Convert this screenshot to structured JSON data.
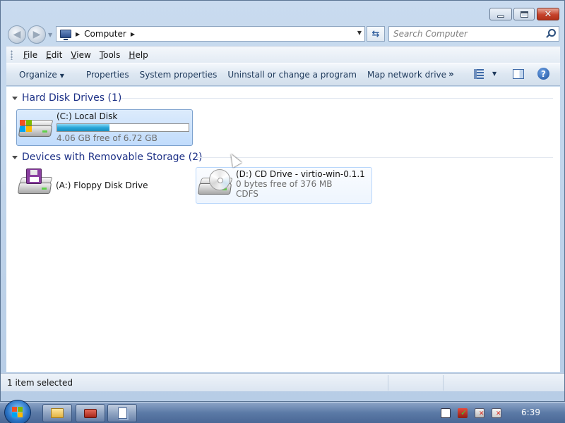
{
  "address": {
    "crumbs": [
      "Computer"
    ]
  },
  "search": {
    "placeholder": "Search Computer"
  },
  "menu": {
    "items": [
      {
        "label": "File",
        "accel": "F",
        "rest": "ile"
      },
      {
        "label": "Edit",
        "accel": "E",
        "rest": "dit"
      },
      {
        "label": "View",
        "accel": "V",
        "rest": "iew"
      },
      {
        "label": "Tools",
        "accel": "T",
        "rest": "ools"
      },
      {
        "label": "Help",
        "accel": "H",
        "rest": "elp"
      }
    ]
  },
  "commands": {
    "organize": "Organize",
    "properties": "Properties",
    "system_properties": "System properties",
    "uninstall": "Uninstall or change a program",
    "map_drive": "Map network drive",
    "more": "»"
  },
  "groups": {
    "hard_disk": {
      "label": "Hard Disk Drives (1)",
      "items": [
        {
          "name": "(C:) Local Disk",
          "free_text": "4.06 GB free of 6.72 GB",
          "used_fraction": 0.4
        }
      ]
    },
    "removable": {
      "label": "Devices with Removable Storage (2)",
      "items": [
        {
          "name": "(A:) Floppy Disk Drive"
        },
        {
          "name": "(D:) CD Drive - virtio-win-0.1.1",
          "free_text": "0 bytes free of 376 MB",
          "fs": "CDFS"
        }
      ]
    }
  },
  "status": {
    "text": "1 item selected"
  },
  "taskbar": {
    "clock": "6:39"
  },
  "colors": {
    "group_header": "#1e3287",
    "bar_fill": "#27a6d9",
    "selection": "#c1dcfc"
  }
}
